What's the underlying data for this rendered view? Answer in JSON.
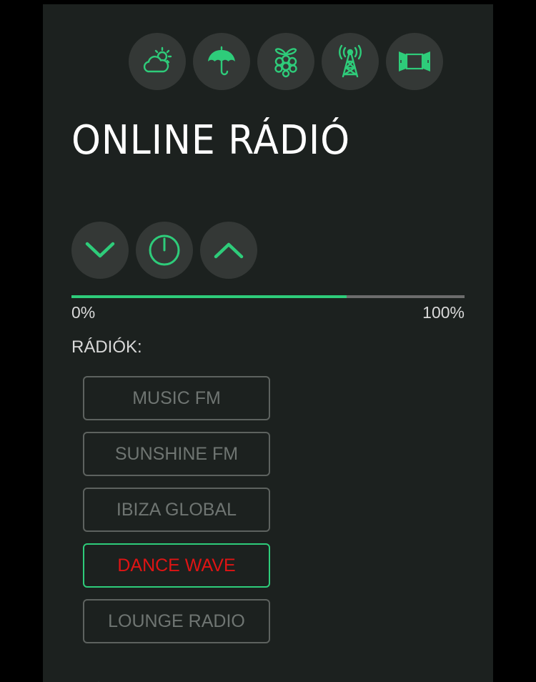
{
  "header": {
    "title": "ONLINE RÁDIÓ",
    "nav": [
      {
        "icon": "weather-cloud-sun-icon"
      },
      {
        "icon": "umbrella-icon"
      },
      {
        "icon": "raspberry-pi-icon"
      },
      {
        "icon": "radio-tower-icon"
      },
      {
        "icon": "window-shutters-icon"
      }
    ]
  },
  "controls": {
    "volume_down_icon": "chevron-down-icon",
    "power_icon": "power-icon",
    "volume_up_icon": "chevron-up-icon"
  },
  "volume": {
    "level_fraction": 0.7,
    "min_label": "0%",
    "max_label": "100%"
  },
  "stations": {
    "label": "RÁDIÓK:",
    "items": [
      {
        "name": "MUSIC FM",
        "active": false
      },
      {
        "name": "SUNSHINE FM",
        "active": false
      },
      {
        "name": "IBIZA GLOBAL",
        "active": false
      },
      {
        "name": "DANCE WAVE",
        "active": true
      },
      {
        "name": "LOUNGE RADIO",
        "active": false
      }
    ]
  },
  "colors": {
    "accent": "#2ecc7a",
    "active_text": "#e01414",
    "panel_background": "#1c211f",
    "button_background": "#343836",
    "inactive_text": "#6f7572"
  }
}
